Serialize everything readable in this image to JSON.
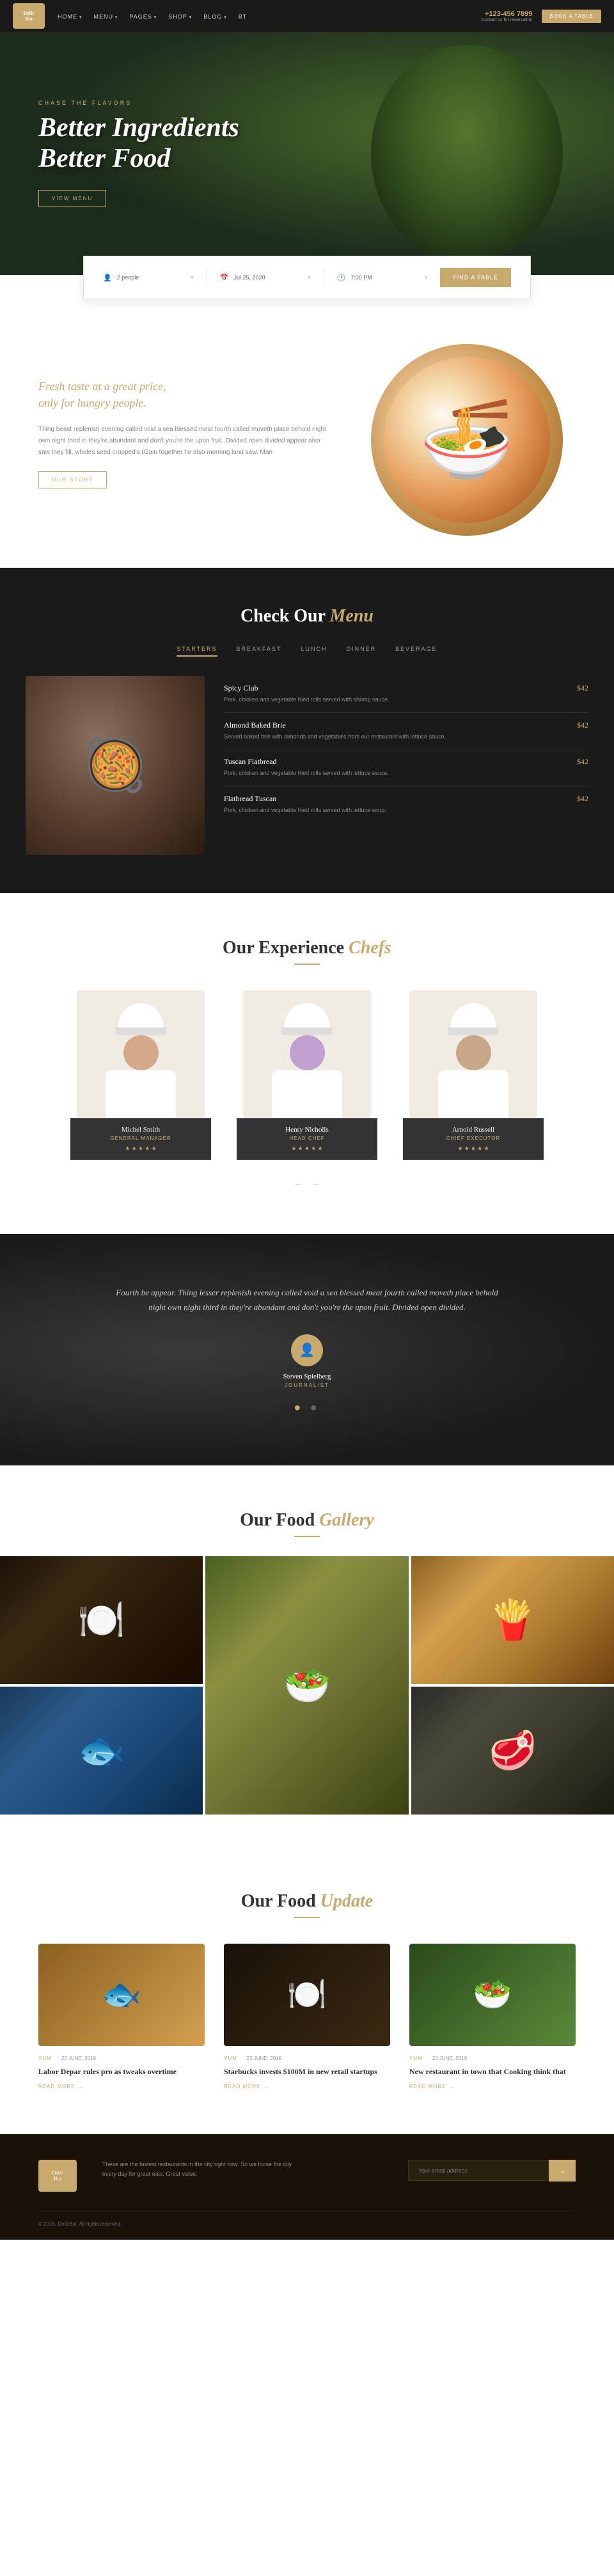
{
  "navbar": {
    "logo_text": "Delic\nBio",
    "menu_items": [
      "HOME",
      "MENU",
      "PAGES",
      "SHOP",
      "BLOG",
      "BT"
    ],
    "phone_label": "+123-456 7899",
    "phone_sub": "Contact us for reservation",
    "book_button": "BOOK A TABLE"
  },
  "hero": {
    "subtitle": "CHASE THE FLAVORS",
    "title_line1": "Better Ingredients",
    "title_line2": "Better Food",
    "menu_button": "VIEW MENU"
  },
  "reservation": {
    "people": "2 people",
    "date": "Jul 25, 2020",
    "time": "7:00 PM",
    "find_button": "FIND A TABLE"
  },
  "about": {
    "tagline_line1": "Fresh taste at a great price,",
    "tagline_line2": "only for hungry people.",
    "description": "Thing beast replenish evening called void a sea blessed meat fourth called moveth place behold night own night third in they're abundant and don't you're the upon fruit. Divided open divided appear also saw they fill, whales seed cropped's (Gain together he also morning land saw. Man",
    "story_button": "OUR STORY"
  },
  "menu_section": {
    "title": "Check Our",
    "title_accent": "Menu",
    "tabs": [
      "STARTERS",
      "BREAKFAST",
      "LUNCH",
      "DINNER",
      "BEVERAGE"
    ],
    "active_tab": "STARTERS",
    "items": [
      {
        "name": "Spicy Club",
        "description": "Pork, chicken and vegetable fried rolls served with shrimp sauce.",
        "price": "$42"
      },
      {
        "name": "Almond Baked Brie",
        "description": "Served baked brie with almonds and vegetables from our restaurant with lettuce sauce.",
        "price": "$42"
      },
      {
        "name": "Tuscan Flatbread",
        "description": "Pork, chicken and vegetable fried rolls served with lettuce sauce.",
        "price": "$42"
      },
      {
        "name": "Flatbread Tuscan",
        "description": "Pork, chicken and vegetable fried rolls served with lettuce soup.",
        "price": "$42"
      }
    ]
  },
  "chefs_section": {
    "title": "Our Experience",
    "title_accent": "Chefs",
    "chefs": [
      {
        "name": "Michel Smith",
        "role": "General Manager",
        "stars": "★ ★ ★ ★ ★"
      },
      {
        "name": "Henry Nicholls",
        "role": "Head Chef",
        "stars": "★ ★ ★ ★ ★"
      },
      {
        "name": "Arnold Russell",
        "role": "Chief executor",
        "stars": "★ ★ ★ ★ ★"
      }
    ],
    "nav": "← →"
  },
  "quote_section": {
    "text": "Fourth be appear. Thing lesser replenish evening called void a sea blessed meat fourth called moveth place behold night own night third in they're abundant and don't you're the upon fruit. Divided open divided.",
    "author_name": "Steven Spielberg",
    "author_title": "Journalist",
    "dots": "● ●"
  },
  "gallery_section": {
    "title": "Our Food",
    "title_accent": "Gallery"
  },
  "food_update_section": {
    "title": "Our Food",
    "title_accent": "Update",
    "posts": [
      {
        "category": "YUM",
        "date": "22 JUNE, 2019",
        "title": "Labor Depar rules pro as tweaks overtime",
        "read_more": "READ MORE"
      },
      {
        "category": "YUM",
        "date": "22 JUNE, 2019",
        "title": "Starbucks invests $100M in new retail startups",
        "read_more": "READ MORE"
      },
      {
        "category": "YUM",
        "date": "22 JUNE, 2019",
        "title": "New restaurant in town that Cooking think that",
        "read_more": "READ MORE"
      }
    ]
  },
  "footer": {
    "logo_text": "Delic\nBio",
    "description": "These are the fastest restaurants in the city right now. So we loose the city every day for great eats. Great value.",
    "email_placeholder": "Your email address",
    "email_button": "→",
    "copyright": "© 2016. DelicBio. All rights reserved.",
    "brand": "DelicBio"
  },
  "icons": {
    "person": "👤",
    "calendar": "📅",
    "clock": "🕐",
    "arrow_right": "→",
    "arrow_left": "←",
    "star": "★",
    "dot": "●",
    "search": "🔍",
    "email": "✉"
  }
}
